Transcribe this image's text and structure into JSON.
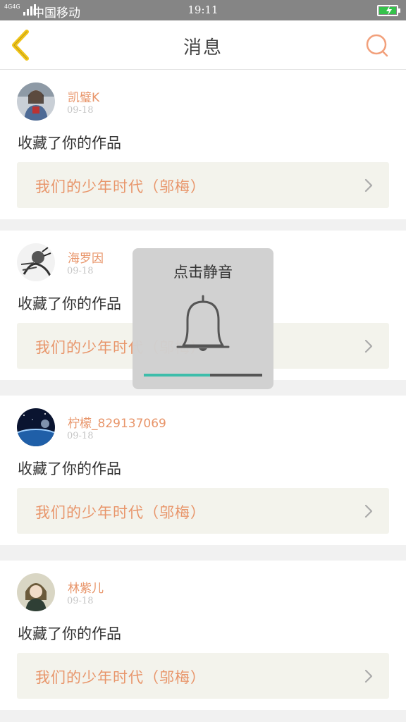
{
  "status_bar": {
    "network": "4G4G",
    "carrier": "中国移动",
    "time": "19:11",
    "battery_color": "#35c24b"
  },
  "header": {
    "title": "消息",
    "back_icon": "chevron-left-icon",
    "search_icon": "search-icon",
    "accent": "#f0c419",
    "search_color": "#f2a07b"
  },
  "messages": [
    {
      "username": "凯璧K",
      "date": "09-18",
      "action": "收藏了你的作品",
      "work_title": "我们的少年时代（邬梅）",
      "avatar": "photo-girl-denim"
    },
    {
      "username": "海罗因",
      "date": "09-18",
      "action": "收藏了你的作品",
      "work_title": "我们的少年时代（邬梅）",
      "avatar": "sketch-character"
    },
    {
      "username": "柠檬_829137069",
      "date": "09-18",
      "action": "收藏了你的作品",
      "work_title": "我们的少年时代（邬梅）",
      "avatar": "planet-space"
    },
    {
      "username": "林紫儿",
      "date": "09-18",
      "action": "收藏了你的作品",
      "work_title": "我们的少年时代（邬梅）",
      "avatar": "anime-girl"
    }
  ],
  "mute_toast": {
    "label": "点击静音",
    "icon": "bell-icon",
    "volume_fraction": 0.56,
    "fill_color": "#3dbdaa"
  }
}
